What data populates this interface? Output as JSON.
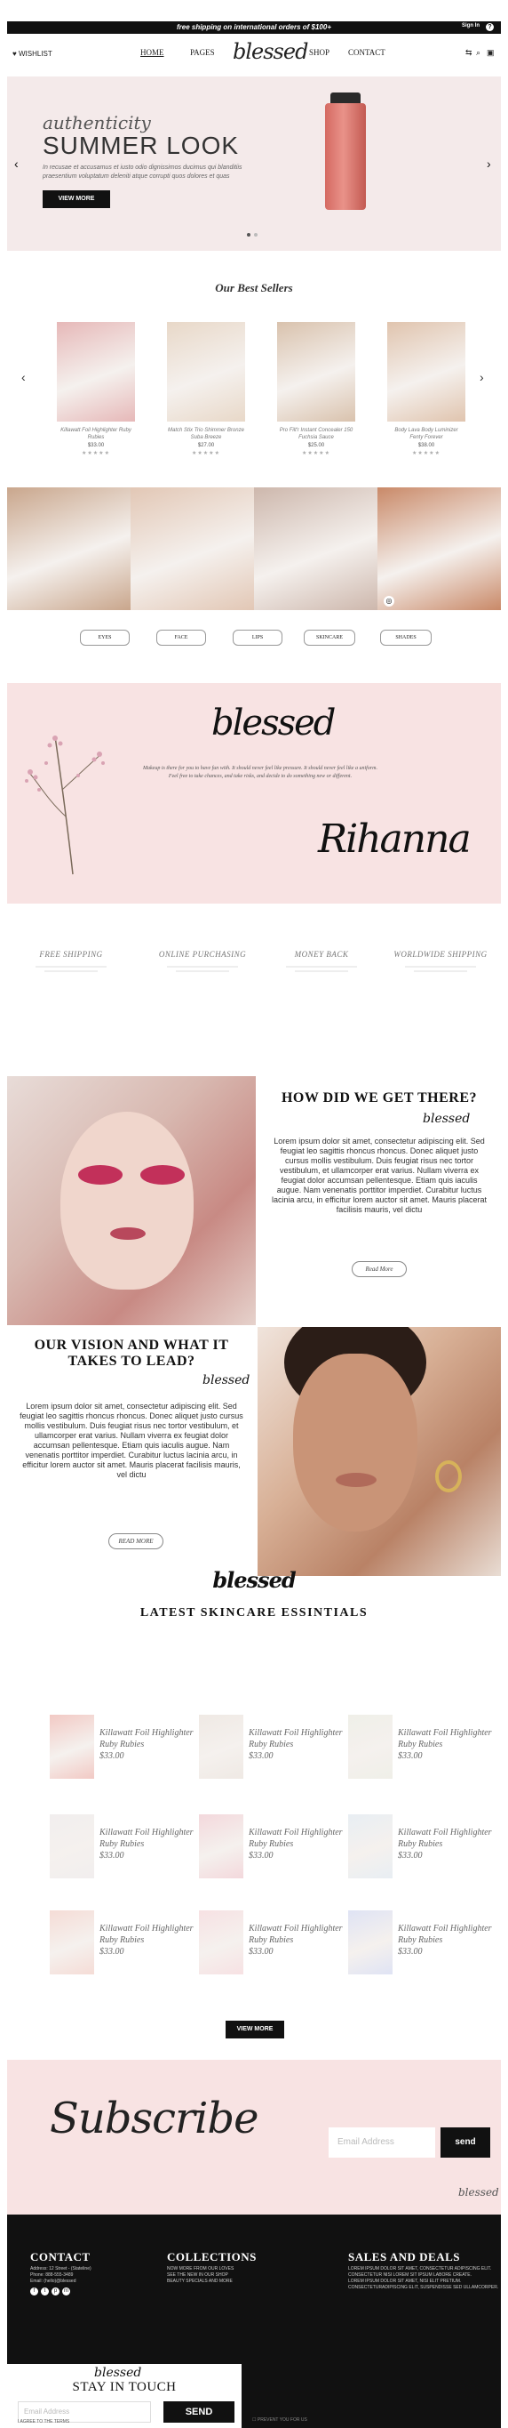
{
  "topbar": {
    "promo": "free shipping on international orders of $100+",
    "signin": "Sign In",
    "help": "?"
  },
  "header": {
    "wishlist": "WISHLIST",
    "logo": "blessed",
    "nav": [
      "HOME",
      "PAGES",
      "SHOP",
      "CONTACT"
    ],
    "icons": [
      "compare-icon",
      "search-icon",
      "bag-icon"
    ]
  },
  "hero": {
    "script": "authenticity",
    "title": "SUMMER LOOK",
    "desc": "In recusae et accusamus et iusto odio dignissimos ducimus qui blanditiis praesentium voluptatum deleniti atque corrupti quos dolores et quas",
    "button": "VIEW MORE",
    "prev": "‹",
    "next": "›"
  },
  "bestsellers": {
    "title": "Our Best Sellers",
    "items": [
      {
        "name": "Killawatt Foil Highlighter Ruby Rubies",
        "price": "$33.00",
        "stars": "★★★★★",
        "color": "#e6b8b8"
      },
      {
        "name": "Match Stix Trio Shimmer Bronze Suba Breeze",
        "price": "$27.00",
        "stars": "★★★★★",
        "color": "#e8d8c8"
      },
      {
        "name": "Pro Filt'r Instant Concealer 150 Fuchsia Sauce",
        "price": "$25.00",
        "stars": "★★★★★",
        "color": "#d9c2ad"
      },
      {
        "name": "Body Lava Body Luminizer Fenty Forever",
        "price": "$38.00",
        "stars": "★★★★★",
        "color": "#e0c4ae"
      }
    ]
  },
  "gallery": [
    "#c9a68c",
    "#e2c7b5",
    "#cdb7ac",
    "#c98968"
  ],
  "categories": [
    "EYES",
    "FACE",
    "LIPS",
    "SKINCARE",
    "SHADES"
  ],
  "brand": {
    "logo": "blessed",
    "text": "Makeup is there for you to have fun with. It should never feel like pressure. It should never feel like a uniform. Feel free to take chances, and take risks, and decide to do something new or different.",
    "signature": "Rihanna"
  },
  "features": [
    "FREE SHIPPING",
    "ONLINE PURCHASING",
    "MONEY BACK",
    "WORLDWIDE SHIPPING"
  ],
  "story1": {
    "title": "HOW DID WE GET THERE?",
    "mini": "blessed",
    "text": "Lorem ipsum dolor sit amet, consectetur adipiscing elit. Sed feugiat leo sagittis rhoncus rhoncus. Donec aliquet justo cursus mollis vestibulum. Duis feugiat risus nec tortor vestibulum, et ullamcorper erat varius. Nullam viverra ex feugiat dolor accumsan pellentesque. Etiam quis iaculis augue. Nam venenatis porttitor imperdiet. Curabitur luctus lacinia arcu, in efficitur lorem auctor sit amet. Mauris placerat facilisis mauris, vel dictu",
    "button": "Read More"
  },
  "story2": {
    "title": "OUR VISION AND WHAT IT TAKES TO LEAD?",
    "mini": "blessed",
    "text": "Lorem ipsum dolor sit amet, consectetur adipiscing elit. Sed feugiat leo sagittis rhoncus rhoncus. Donec aliquet justo cursus mollis vestibulum. Duis feugiat risus nec tortor vestibulum, et ullamcorper erat varius. Nullam viverra ex feugiat dolor accumsan pellentesque. Etiam quis iaculis augue. Nam venenatis porttitor imperdiet. Curabitur luctus lacinia arcu, in efficitur lorem auctor sit amet. Mauris placerat facilisis mauris, vel dictu",
    "button": "READ MORE"
  },
  "skincare": {
    "logo": "blessed",
    "title": "LATEST SKINCARE ESSINTIALS",
    "items": [
      {
        "l1": "Killawatt Foil Highlighter",
        "l2": "Ruby Rubies",
        "price": "$33.00",
        "color": "#f2c9c4"
      },
      {
        "l1": "Killawatt Foil Highlighter",
        "l2": "Ruby Rubies",
        "price": "$33.00",
        "color": "#efe9e4"
      },
      {
        "l1": "Killawatt Foil Highlighter",
        "l2": "Ruby Rubies",
        "price": "$33.00",
        "color": "#efefe8"
      },
      {
        "l1": "Killawatt Foil Highlighter",
        "l2": "Ruby Rubies",
        "price": "$33.00",
        "color": "#f1eeee"
      },
      {
        "l1": "Killawatt Foil Highlighter",
        "l2": "Ruby Rubies",
        "price": "$33.00",
        "color": "#f3d8dc"
      },
      {
        "l1": "Killawatt Foil Highlighter",
        "l2": "Ruby Rubies",
        "price": "$33.00",
        "color": "#e8eef3"
      },
      {
        "l1": "Killawatt Foil Highlighter",
        "l2": "Ruby Rubies",
        "price": "$33.00",
        "color": "#f5dcd6"
      },
      {
        "l1": "Killawatt Foil Highlighter",
        "l2": "Ruby Rubies",
        "price": "$33.00",
        "color": "#f7e1e3"
      },
      {
        "l1": "Killawatt Foil Highlighter",
        "l2": "Ruby Rubies",
        "price": "$33.00",
        "color": "#dfe3f4"
      }
    ],
    "button": "VIEW MORE"
  },
  "subscribe": {
    "word": "Subscribe",
    "placeholder": "Email Address",
    "button": "send",
    "mini": "blessed"
  },
  "footer": {
    "contact": {
      "title": "CONTACT",
      "lines": [
        "Address: 12 Street - (Stateline)",
        "Phone: 888-555-3489",
        "Email: (hello)@blessed"
      ]
    },
    "collections": {
      "title": "COLLECTIONS",
      "lines": [
        "NOW MORE FROM OUR LOVES",
        "SEE THE NEW IN OUR SHOP",
        "BEAUTY SPECIALS AND MORE"
      ]
    },
    "sales": {
      "title": "SALES AND DEALS",
      "lines": [
        "LOREM IPSUM DOLOR SIT AMET, CONSECTETUR ADIPISCING ELIT.",
        "CONSECTETUR NISI LOREM SIT IPSUM LABORE CREATE.",
        "LOREM IPSUM DOLOR SIT AMET, NISI ELIT PRETIUM.",
        "CONSECTETURADIPISCING ELIT, SUSPENDISSE SED ULLAMCORPER."
      ]
    },
    "newsletter": {
      "logo": "blessed",
      "title": "STAY IN TOUCH",
      "placeholder": "Email Address",
      "button": "SEND",
      "consent": "I AGREE TO THE TERMS",
      "privacy": "PREVENT YOU FOR US"
    },
    "social": [
      "f",
      "t",
      "p",
      "m"
    ]
  }
}
